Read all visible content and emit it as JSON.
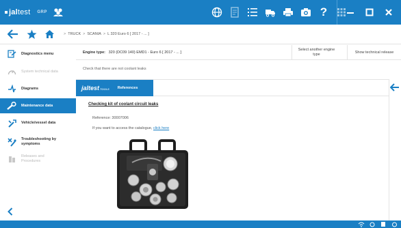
{
  "app": {
    "brand_name_bold": "jal",
    "brand_name_thin": "test",
    "brand_sub": "GRP",
    "accent_color": "#1a7fc4"
  },
  "toolbar": {
    "icons": [
      "globe-icon",
      "document-icon",
      "list-icon",
      "truck-icon",
      "printer-icon",
      "camera-icon",
      "help-icon",
      "grid-icon"
    ],
    "help_label": "?"
  },
  "window": {
    "buttons": [
      "minimize-icon",
      "maximize-icon",
      "close-icon"
    ]
  },
  "nav": {
    "breadcrumb": [
      "TRUCK",
      "SCANIA",
      "L 320 Euro 6 [ 2017 - ... ]"
    ],
    "separator": ">"
  },
  "sidebar": {
    "items": [
      {
        "label": "Diagnostics menu",
        "icon": "diagnostics-icon",
        "state": "normal"
      },
      {
        "label": "System technical data",
        "icon": "gauge-icon",
        "state": "disabled"
      },
      {
        "label": "Diagrams",
        "icon": "diagram-icon",
        "state": "normal"
      },
      {
        "label": "Maintenance data",
        "icon": "wrench-icon",
        "state": "active"
      },
      {
        "label": "Vehicle/vessel data",
        "icon": "tools-icon",
        "state": "normal"
      },
      {
        "label": "Troubleshooting by symptoms",
        "icon": "troubleshooting-icon",
        "state": "normal"
      },
      {
        "label": "Releases and Procedures",
        "icon": "releases-icon",
        "state": "disabled"
      }
    ]
  },
  "engine": {
    "label": "Engine type:",
    "value": "320 (DC09 140) EMD1 - Euro 6 [ 2017 - ... ]",
    "select_another": "Select another engine type",
    "show_technical": "Show technical release"
  },
  "check_text": "Check that there are not coolant leaks",
  "panel": {
    "tab_logo": "jaltest",
    "tab_logo_sub": "TOOLS",
    "tab_label": "References",
    "title": "Checking kit of coolant circuit leaks",
    "reference": "Reference: 30007006",
    "catalogue_prefix": "If you want to access the catalogue,",
    "catalogue_link": "click here"
  }
}
